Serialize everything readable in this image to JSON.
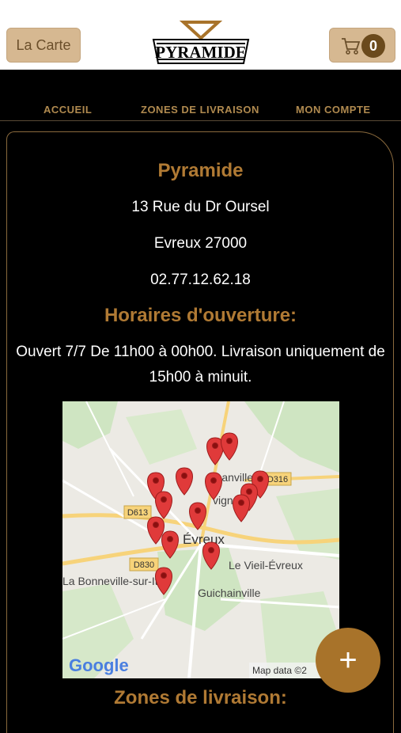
{
  "header": {
    "menu_button_label": "La Carte",
    "logo_text": "PYRAMIDE",
    "cart_count": "0"
  },
  "nav": {
    "items": [
      "ACCUEIL",
      "ZONES DE LIVRAISON",
      "MON COMPTE"
    ]
  },
  "restaurant": {
    "name": "Pyramide",
    "address_line1": "13 Rue du Dr Oursel",
    "address_line2": "Evreux 27000",
    "phone": "02.77.12.62.18"
  },
  "hours": {
    "heading": "Horaires d'ouverture:",
    "line1": "Ouvert 7/7 De 11h00 à 00h00. Livraison uniquement de",
    "line2": "15h00 à minuit."
  },
  "map": {
    "labels": {
      "armanville": "rmanville",
      "evreux": "Évreux",
      "vieil_evreux": "Le Vieil-Évreux",
      "bonneville": "La Bonneville-sur-Iton",
      "guichainville": "Guichainville",
      "vign": "vign"
    },
    "roads": [
      "D613",
      "D830",
      "D316"
    ],
    "google": "Google",
    "attribution": "Map data ©2"
  },
  "zones": {
    "heading": "Zones de livraison:"
  },
  "fab_label": "+",
  "colors": {
    "accent": "#b07a34",
    "button_bg": "#d6b891",
    "fab": "#a8732a",
    "pin": "#e03a3a"
  }
}
